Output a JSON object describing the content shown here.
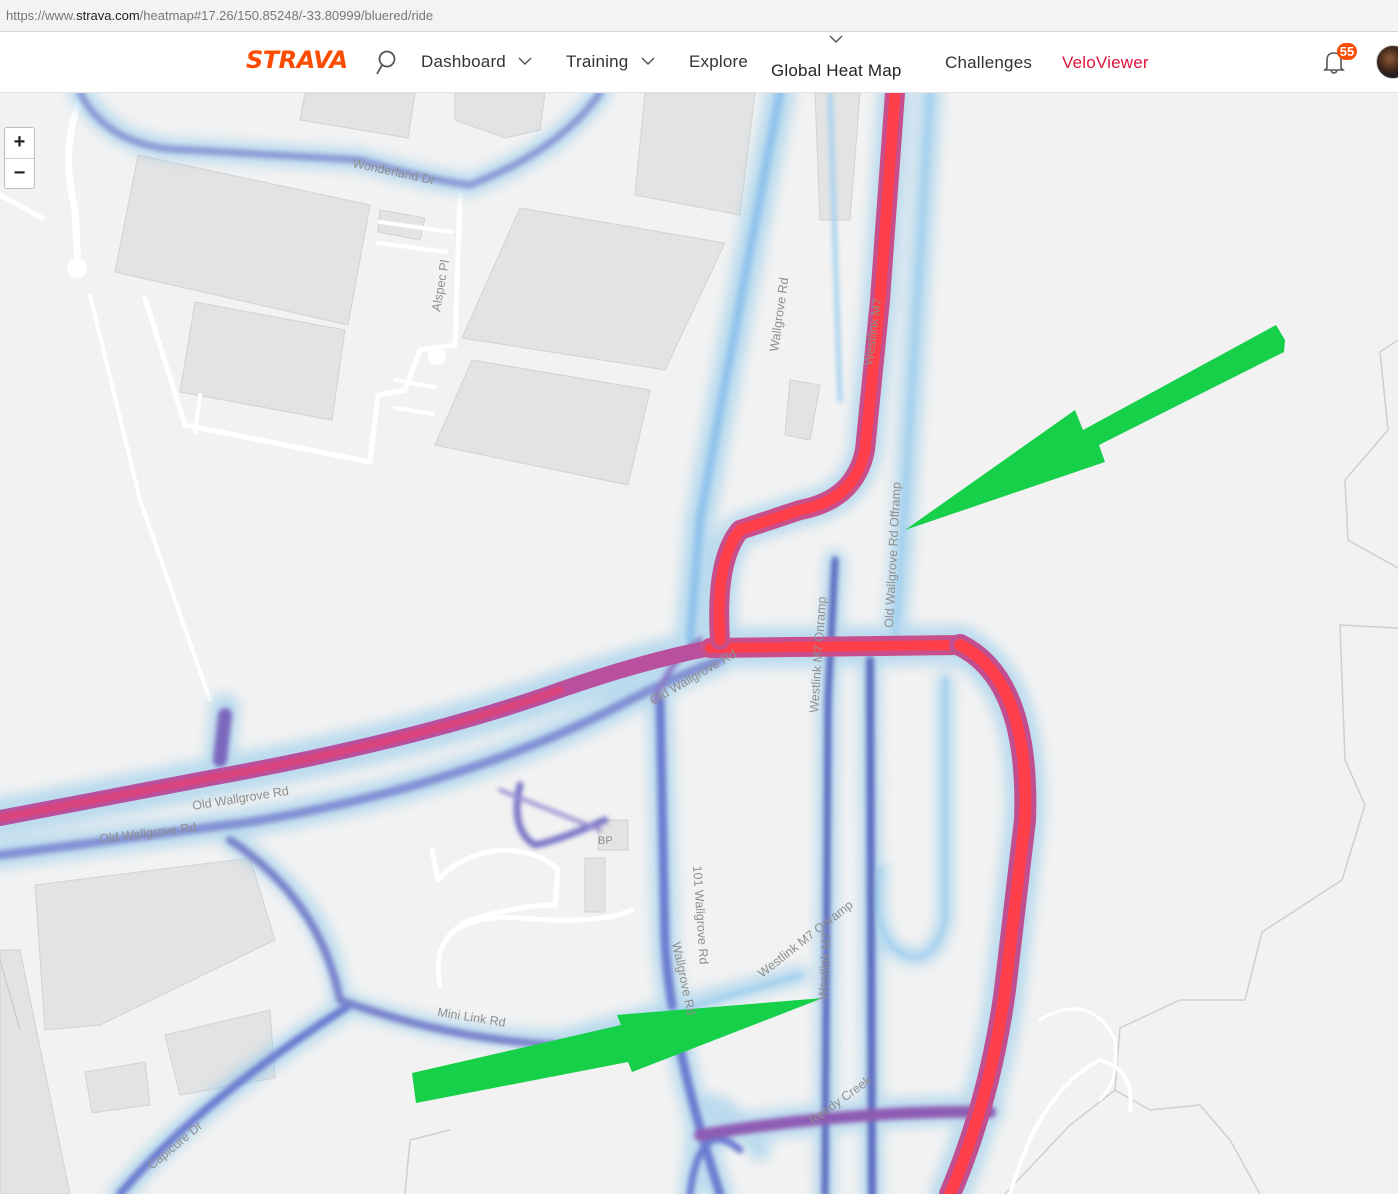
{
  "browser": {
    "url_scheme": "https://www.",
    "url_host": "strava.com",
    "url_path": "/heatmap#17.26/150.85248/-33.80999/bluered/ride"
  },
  "header": {
    "logo": "STRAVA",
    "nav": {
      "dashboard": "Dashboard",
      "training": "Training",
      "explore": "Explore",
      "heatmap": "Global Heat Map",
      "challenges": "Challenges",
      "veloviewer": "VeloViewer"
    },
    "notifications_count": "55"
  },
  "map": {
    "zoom_in": "+",
    "zoom_out": "−",
    "streets": {
      "wonderland": "Wonderland Dr",
      "alspec": "Alspec Pl",
      "wallgrove": "Wallgrove Rd",
      "westlink_m7": "Westlink M7",
      "old_wallgrove_offramp": "Old Wallgrove Rd Offramp",
      "westlink_onramp_upper": "Westlink M7 Onramp",
      "old_wallgrove_upper": "Old Wallgrove Rd",
      "old_wallgrove_left1": "Old Wallgrove Rd",
      "old_wallgrove_left2": "Old Wallgrove Rd",
      "bp": "BP",
      "wallgrove_101": "101 Wallgrove Rd",
      "wallgrove_lower": "Wallgrove Rd",
      "westlink_onramp_lower": "Westlink M7 Onramp",
      "westlink_lower": "Westlink M7",
      "mini_link": "Mini Link Rd",
      "reedy_creek": "Reedy Creek",
      "eastern_creek": "Capicure Dr"
    },
    "colors": {
      "heat_low": "#8ec8ea",
      "heat_mid": "#6a78c8",
      "heat_high": "#ff3b47",
      "arrow": "#17d04a"
    }
  }
}
